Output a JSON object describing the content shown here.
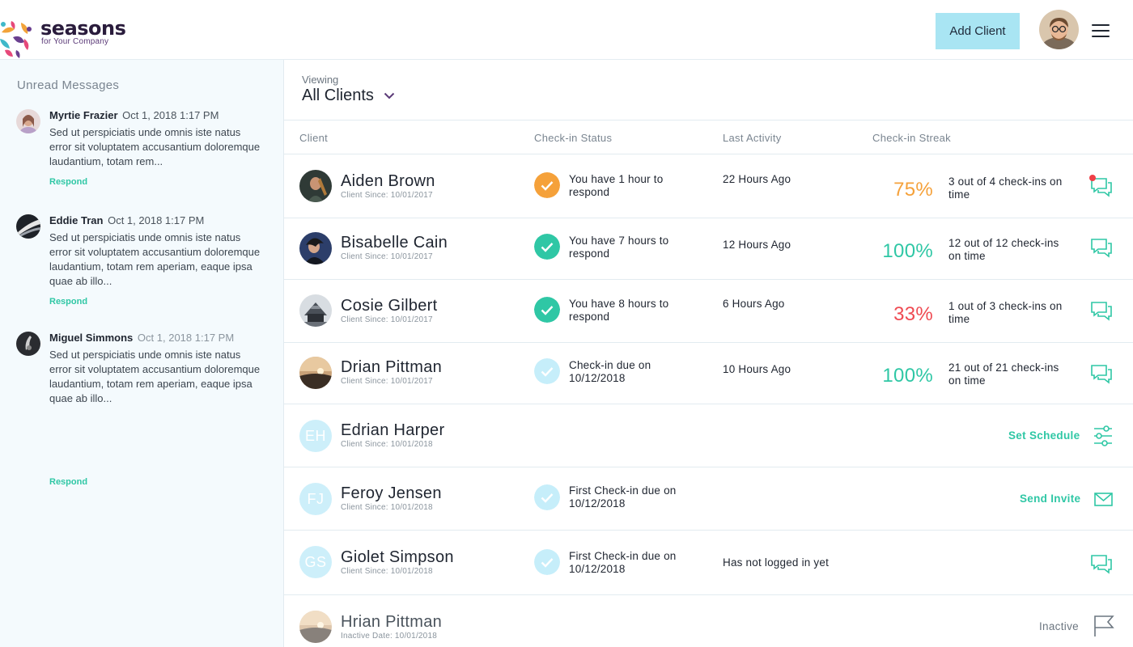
{
  "brand": {
    "name": "seasons",
    "tagline": "for Your Company"
  },
  "header": {
    "add_client_label": "Add Client",
    "avatar_icon": "user-avatar",
    "menu_icon": "hamburger-menu-icon"
  },
  "sidebar": {
    "title": "Unread Messages",
    "messages": [
      {
        "name": "Myrtie Frazier",
        "date": "Oct 1, 2018 1:17 PM",
        "body": "Sed ut perspiciatis unde omnis iste natus error sit voluptatem accusantium doloremque laudantium, totam rem...",
        "respond": "Respond"
      },
      {
        "name": "Eddie Tran",
        "date": "Oct 1, 2018 1:17 PM",
        "body": "Sed ut perspiciatis unde omnis iste natus error sit voluptatem accusantium doloremque laudantium, totam rem aperiam, eaque ipsa quae ab illo...",
        "respond": "Respond"
      },
      {
        "name": "Miguel Simmons",
        "date": "Oct 1, 2018 1:17 PM",
        "body": "Sed ut perspiciatis unde omnis iste natus error sit voluptatem accusantium doloremque laudantium, totam rem aperiam, eaque ipsa quae ab illo...",
        "respond": "Respond"
      }
    ]
  },
  "main": {
    "viewing_label": "Viewing",
    "viewing_value": "All Clients",
    "columns": [
      "Client",
      "Check-in Status",
      "Last Activity",
      "Check-in Streak"
    ],
    "clients": [
      {
        "name": "Aiden Brown",
        "since": "Client Since: 10/01/2017",
        "status": "You have 1 hour to respond",
        "status_type": "warning",
        "activity": "22 Hours Ago",
        "pct": "75%",
        "pct_color": "#f5a13a",
        "streak": "3 out of 4 check-ins on time",
        "action": "chat",
        "unread": true
      },
      {
        "name": "Bisabelle Cain",
        "since": "Client Since: 10/01/2017",
        "status": "You have 7 hours to respond",
        "status_type": "ok",
        "activity": "12 Hours Ago",
        "pct": "100%",
        "pct_color": "#2fc7a5",
        "streak": "12 out of 12 check-ins on time",
        "action": "chat"
      },
      {
        "name": "Cosie Gilbert",
        "since": "Client Since: 10/01/2017",
        "status": "You have 8 hours to respond",
        "status_type": "ok",
        "activity": "6 Hours Ago",
        "pct": "33%",
        "pct_color": "#ef4a52",
        "streak": "1 out of 3 check-ins on time",
        "action": "chat"
      },
      {
        "name": "Drian Pittman",
        "since": "Client Since: 10/01/2017",
        "status": "Check-in due on 10/12/2018",
        "status_type": "pending",
        "activity": "10 Hours Ago",
        "pct": "100%",
        "pct_color": "#2fc7a5",
        "streak": "21 out of 21 check-ins on time",
        "action": "chat"
      },
      {
        "name": "Edrian Harper",
        "initials": "EH",
        "since": "Client Since: 10/01/2018",
        "action": "schedule",
        "action_label": "Set Schedule"
      },
      {
        "name": "Feroy Jensen",
        "initials": "FJ",
        "since": "Client Since: 10/01/2018",
        "status": "First Check-in due on 10/12/2018",
        "status_type": "pending",
        "action": "invite",
        "action_label": "Send Invite"
      },
      {
        "name": "Giolet Simpson",
        "initials": "GS",
        "since": "Client Since: 10/01/2018",
        "status": "First Check-in due on 10/12/2018",
        "status_type": "pending",
        "activity": "Has not logged in yet",
        "action": "chat"
      },
      {
        "name": "Hrian Pittman",
        "since": "Inactive Date: 10/01/2018",
        "action": "inactive",
        "action_label": "Inactive"
      }
    ]
  },
  "colors": {
    "accent": "#2fc7a5",
    "warning": "#f5a13a",
    "danger": "#ef4a52",
    "pending": "#c6eefa",
    "button": "#a9e5f3"
  }
}
